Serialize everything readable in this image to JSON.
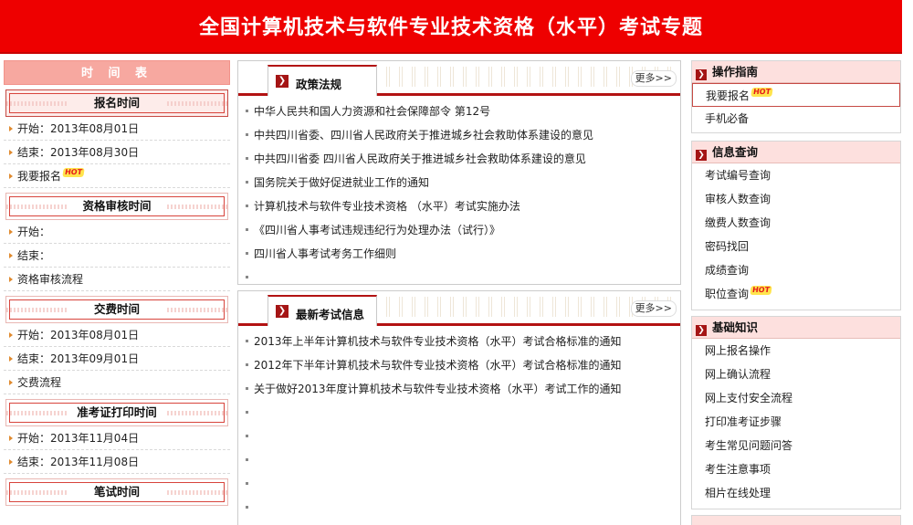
{
  "banner": {
    "title": "全国计算机技术与软件专业技术资格（水平）考试专题"
  },
  "schedule": {
    "header": "时 间 表",
    "sections": [
      {
        "title": "报名时间",
        "items": [
          "开始：2013年08月01日",
          "结束：2013年08月30日",
          "我要报名"
        ]
      },
      {
        "title": "资格审核时间",
        "items": [
          "开始：",
          "结束：",
          "资格审核流程"
        ]
      },
      {
        "title": "交费时间",
        "items": [
          "开始：2013年08月01日",
          "结束：2013年09月01日",
          "交费流程"
        ]
      },
      {
        "title": "准考证打印时间",
        "items": [
          "开始：2013年11月04日",
          "结束：2013年11月08日"
        ]
      },
      {
        "title": "笔试时间",
        "items": []
      }
    ]
  },
  "policy": {
    "tab": "政策法规",
    "more": "更多>>",
    "items": [
      "中华人民共和国人力资源和社会保障部令 第12号",
      "中共四川省委、四川省人民政府关于推进城乡社会救助体系建设的意见",
      "中共四川省委 四川省人民政府关于推进城乡社会救助体系建设的意见",
      "国务院关于做好促进就业工作的通知",
      "计算机技术与软件专业技术资格 （水平）考试实施办法",
      "《四川省人事考试违规违纪行为处理办法（试行）》",
      "四川省人事考试考务工作细则",
      ""
    ]
  },
  "news": {
    "tab": "最新考试信息",
    "more": "更多>>",
    "items": [
      "2013年上半年计算机技术与软件专业技术资格（水平）考试合格标准的通知",
      "2012年下半年计算机技术与软件专业技术资格（水平）考试合格标准的通知",
      "关于做好2013年度计算机技术与软件专业技术资格（水平）考试工作的通知",
      "",
      "",
      "",
      "",
      "",
      ""
    ]
  },
  "guide": {
    "title": "操作指南",
    "items": [
      "我要报名",
      "手机必备"
    ]
  },
  "query": {
    "title": "信息查询",
    "items": [
      "考试编号查询",
      "审核人数查询",
      "缴费人数查询",
      "密码找回",
      "成绩查询",
      "职位查询"
    ]
  },
  "basics": {
    "title": "基础知识",
    "items": [
      "网上报名操作",
      "网上确认流程",
      "网上支付安全流程",
      "打印准考证步骤",
      "考生常见问题问答",
      "考生注意事项",
      "相片在线处理"
    ]
  },
  "badge": {
    "hot": "HOT"
  }
}
